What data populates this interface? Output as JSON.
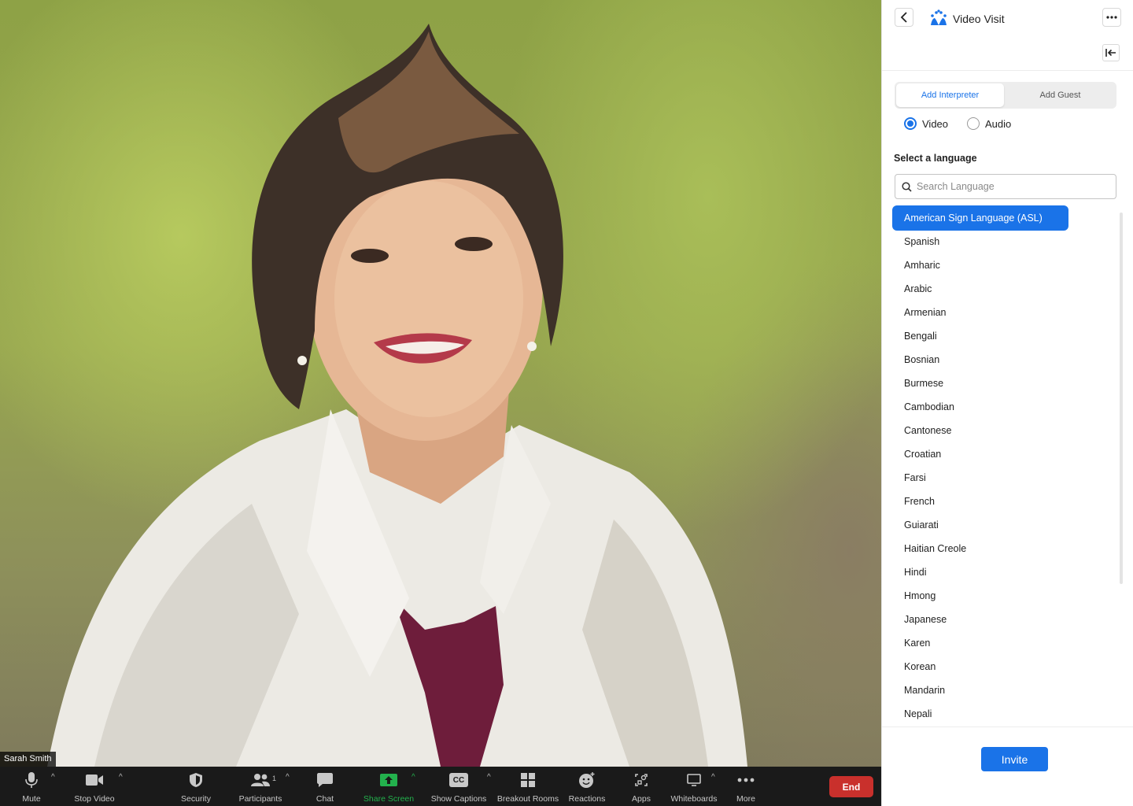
{
  "video": {
    "participant_name": "Sarah Smith"
  },
  "toolbar": {
    "mute": "Mute",
    "stop_video": "Stop Video",
    "security": "Security",
    "participants": "Participants",
    "participants_count": "1",
    "chat": "Chat",
    "share_screen": "Share Screen",
    "show_captions": "Show Captions",
    "captions_icon_text": "CC",
    "breakout_rooms": "Breakout Rooms",
    "reactions": "Reactions",
    "apps": "Apps",
    "whiteboards": "Whiteboards",
    "more": "More",
    "end": "End",
    "caret": "^"
  },
  "panel": {
    "title": "Video Visit",
    "tabs": [
      {
        "label": "Add Interpreter",
        "active": true
      },
      {
        "label": "Add Guest",
        "active": false
      }
    ],
    "mode_options": [
      {
        "label": "Video",
        "selected": true
      },
      {
        "label": "Audio",
        "selected": false
      }
    ],
    "section_label": "Select a language",
    "search_placeholder": "Search Language",
    "languages": [
      "American Sign Language (ASL)",
      "Spanish",
      "Amharic",
      "Arabic",
      "Armenian",
      "Bengali",
      "Bosnian",
      "Burmese",
      "Cambodian",
      "Cantonese",
      "Croatian",
      "Farsi",
      "French",
      "Guiarati",
      "Haitian Creole",
      "Hindi",
      "Hmong",
      "Japanese",
      "Karen",
      "Korean",
      "Mandarin",
      "Nepali"
    ],
    "selected_language_index": 0,
    "invite": "Invite"
  },
  "colors": {
    "accent": "#1a73e8",
    "end": "#c9302c",
    "share_green": "#23b14d"
  }
}
